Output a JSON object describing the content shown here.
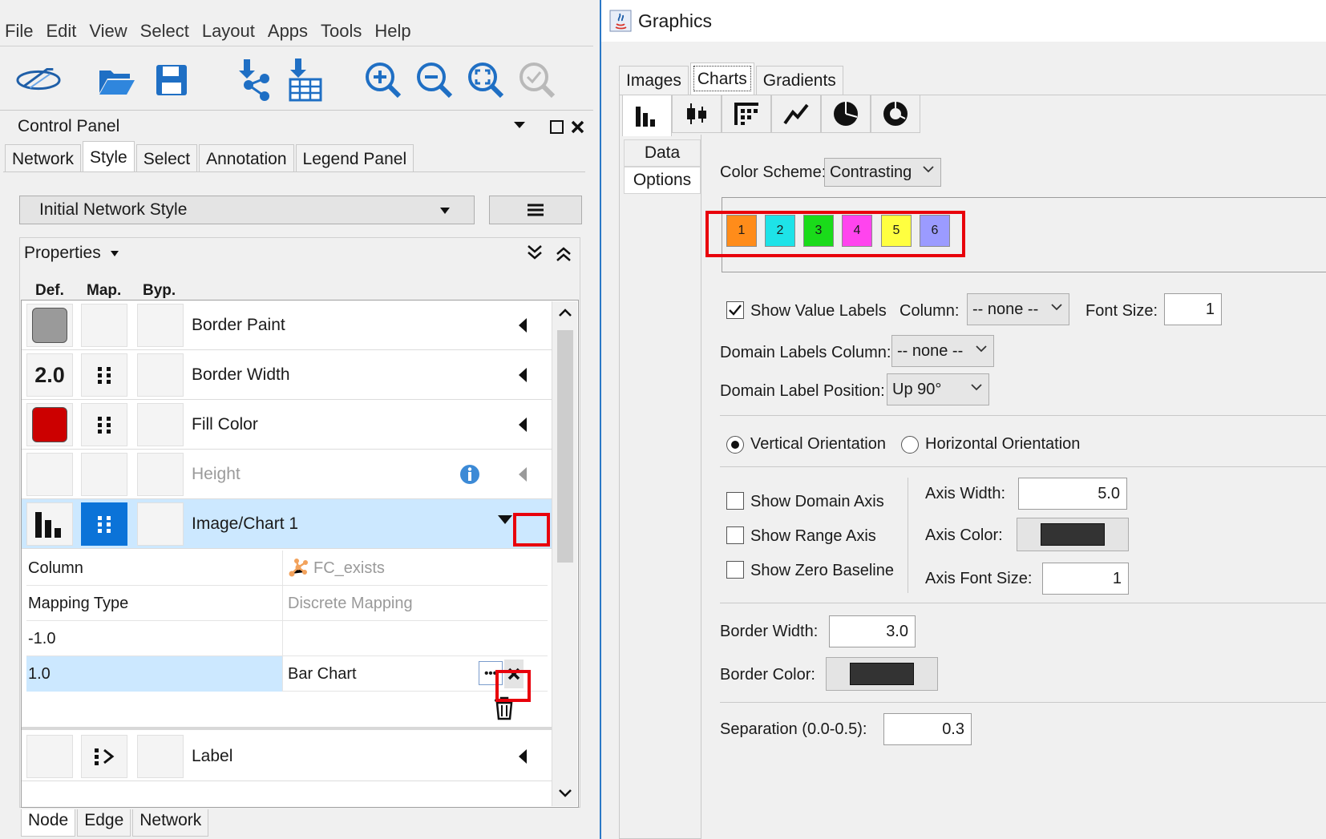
{
  "menu": [
    "File",
    "Edit",
    "View",
    "Select",
    "Layout",
    "Apps",
    "Tools",
    "Help"
  ],
  "control_panel": {
    "title": "Control Panel",
    "tabs": [
      "Network",
      "Style",
      "Select",
      "Annotation",
      "Legend Panel"
    ],
    "active_tab": "Style"
  },
  "style": {
    "selected_style": "Initial Network Style",
    "properties_label": "Properties",
    "col_headers": [
      "Def.",
      "Map.",
      "Byp."
    ],
    "rows": [
      {
        "label": "Border Paint"
      },
      {
        "label": "Border Width",
        "def_value": "2.0"
      },
      {
        "label": "Fill Color"
      },
      {
        "label": "Height"
      },
      {
        "label": "Image/Chart 1"
      },
      {
        "label": "Label"
      }
    ],
    "mapping": {
      "column_key": "Column",
      "column_value": "FC_exists",
      "type_key": "Mapping Type",
      "type_value": "Discrete Mapping",
      "entry1_key": "-1.0",
      "entry1_value": "",
      "entry2_key": "1.0",
      "entry2_value": "Bar Chart"
    },
    "colors": {
      "border_paint": "#9a9a9a",
      "fill": "#cc0000",
      "selected_map": "#0b73d8"
    }
  },
  "bottom_tabs": [
    "Node",
    "Edge",
    "Network"
  ],
  "graphics": {
    "title": "Graphics",
    "tabs": [
      "Images",
      "Charts",
      "Gradients"
    ],
    "active_tab": "Charts",
    "side_tabs": [
      "Data",
      "Options"
    ],
    "active_side": "Options",
    "color_scheme_label": "Color Scheme:",
    "color_scheme_value": "Contrasting",
    "swatches": [
      {
        "label": "1",
        "color": "#ff8c1a"
      },
      {
        "label": "2",
        "color": "#1ee3e8"
      },
      {
        "label": "3",
        "color": "#1adb1a"
      },
      {
        "label": "4",
        "color": "#ff44ee"
      },
      {
        "label": "5",
        "color": "#ffff40"
      },
      {
        "label": "6",
        "color": "#9b9bff"
      }
    ],
    "show_value_labels": "Show Value Labels",
    "column_label": "Column:",
    "column_value": "-- none --",
    "font_size_label": "Font Size:",
    "font_size_value": "1",
    "domain_labels_column_label": "Domain Labels Column:",
    "domain_labels_column_value": "-- none --",
    "domain_label_position_label": "Domain Label Position:",
    "domain_label_position_value": "Up 90°",
    "vertical_orientation": "Vertical Orientation",
    "horizontal_orientation": "Horizontal Orientation",
    "show_domain_axis": "Show Domain Axis",
    "show_range_axis": "Show Range Axis",
    "show_zero_baseline": "Show Zero Baseline",
    "axis_width_label": "Axis Width:",
    "axis_width_value": "5.0",
    "axis_color_label": "Axis Color:",
    "axis_font_size_label": "Axis Font Size:",
    "axis_font_size_value": "1",
    "border_width_label": "Border Width:",
    "border_width_value": "3.0",
    "border_color_label": "Border Color:",
    "separation_label": "Separation (0.0-0.5):",
    "separation_value": "0.3"
  }
}
